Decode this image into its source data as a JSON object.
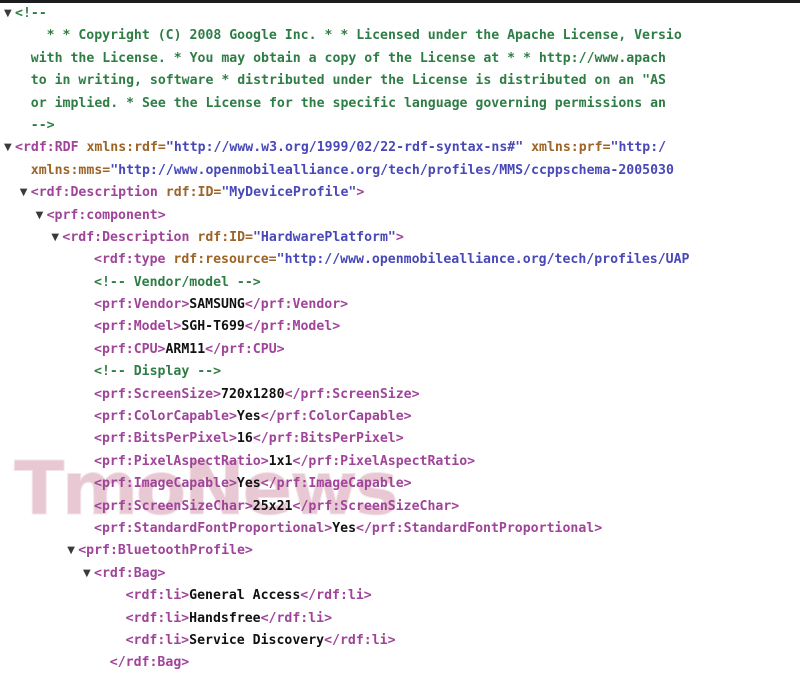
{
  "window": {
    "kind": "browser-xml-source-view",
    "background": "#ffffff"
  },
  "colors": {
    "tag": "#a0449a",
    "attribute_name": "#9c6426",
    "attribute_value": "#4848b8",
    "comment": "#2e7d45",
    "text": "#111111",
    "triangle": "#3a3a3a",
    "watermark": "#e7c4cf",
    "top_bar": "#1c1c1c"
  },
  "watermark": {
    "text": "TmoNews"
  },
  "code": {
    "lines": [
      {
        "id": "l1",
        "triangle": "open",
        "indent": 0,
        "segments": [
          {
            "cls": "comment",
            "text": "<!--"
          }
        ]
      },
      {
        "id": "l2",
        "triangle": "none",
        "indent": 2,
        "segments": [
          {
            "cls": "comment",
            "text": "* * Copyright (C) 2008 Google Inc. * * Licensed under the Apache License, Versio"
          }
        ]
      },
      {
        "id": "l3",
        "triangle": "none",
        "indent": 1,
        "segments": [
          {
            "cls": "comment",
            "text": "with the License. * You may obtain a copy of the License at * * http://www.apach"
          }
        ]
      },
      {
        "id": "l4",
        "triangle": "none",
        "indent": 1,
        "segments": [
          {
            "cls": "comment",
            "text": "to in writing, software * distributed under the License is distributed on an \"AS"
          }
        ]
      },
      {
        "id": "l5",
        "triangle": "none",
        "indent": 1,
        "segments": [
          {
            "cls": "comment",
            "text": "or implied. * See the License for the specific language governing permissions an"
          }
        ]
      },
      {
        "id": "l6",
        "triangle": "none",
        "indent": 1,
        "segments": [
          {
            "cls": "comment",
            "text": "-->"
          }
        ]
      },
      {
        "id": "l7",
        "triangle": "open",
        "indent": 0,
        "segments": [
          {
            "cls": "tag",
            "text": "<rdf:RDF "
          },
          {
            "cls": "attr",
            "text": "xmlns:rdf="
          },
          {
            "cls": "val",
            "text": "\"http://www.w3.org/1999/02/22-rdf-syntax-ns#\" "
          },
          {
            "cls": "attr",
            "text": "xmlns:prf="
          },
          {
            "cls": "val",
            "text": "\"http:/"
          }
        ]
      },
      {
        "id": "l8",
        "triangle": "none",
        "indent": 1,
        "segments": [
          {
            "cls": "attr",
            "text": "xmlns:mms="
          },
          {
            "cls": "val",
            "text": "\"http://www.openmobilealliance.org/tech/profiles/MMS/ccppschema-2005030"
          }
        ]
      },
      {
        "id": "l9",
        "triangle": "open",
        "indent": 1,
        "segments": [
          {
            "cls": "tag",
            "text": "<rdf:Description "
          },
          {
            "cls": "attr",
            "text": "rdf:ID="
          },
          {
            "cls": "val",
            "text": "\"MyDeviceProfile\""
          },
          {
            "cls": "tag",
            "text": ">"
          }
        ]
      },
      {
        "id": "l10",
        "triangle": "open",
        "indent": 2,
        "segments": [
          {
            "cls": "tag",
            "text": "<prf:component>"
          }
        ]
      },
      {
        "id": "l11",
        "triangle": "open",
        "indent": 3,
        "segments": [
          {
            "cls": "tag",
            "text": "<rdf:Description "
          },
          {
            "cls": "attr",
            "text": "rdf:ID="
          },
          {
            "cls": "val",
            "text": "\"HardwarePlatform\""
          },
          {
            "cls": "tag",
            "text": ">"
          }
        ]
      },
      {
        "id": "l12",
        "triangle": "none",
        "indent": 5,
        "segments": [
          {
            "cls": "tag",
            "text": "<rdf:type "
          },
          {
            "cls": "attr",
            "text": "rdf:resource="
          },
          {
            "cls": "val",
            "text": "\"http://www.openmobilealliance.org/tech/profiles/UAP"
          }
        ]
      },
      {
        "id": "l13",
        "triangle": "none",
        "indent": 5,
        "segments": [
          {
            "cls": "comment",
            "text": "<!-- Vendor/model -->"
          }
        ]
      },
      {
        "id": "l14",
        "triangle": "none",
        "indent": 5,
        "segments": [
          {
            "cls": "tag",
            "text": "<prf:Vendor>"
          },
          {
            "cls": "txt",
            "text": "SAMSUNG"
          },
          {
            "cls": "tag",
            "text": "</prf:Vendor>"
          }
        ]
      },
      {
        "id": "l15",
        "triangle": "none",
        "indent": 5,
        "segments": [
          {
            "cls": "tag",
            "text": "<prf:Model>"
          },
          {
            "cls": "txt",
            "text": "SGH-T699"
          },
          {
            "cls": "tag",
            "text": "</prf:Model>"
          }
        ]
      },
      {
        "id": "l16",
        "triangle": "none",
        "indent": 5,
        "segments": [
          {
            "cls": "tag",
            "text": "<prf:CPU>"
          },
          {
            "cls": "txt",
            "text": "ARM11"
          },
          {
            "cls": "tag",
            "text": "</prf:CPU>"
          }
        ]
      },
      {
        "id": "l17",
        "triangle": "none",
        "indent": 5,
        "segments": [
          {
            "cls": "comment",
            "text": "<!-- Display -->"
          }
        ]
      },
      {
        "id": "l18",
        "triangle": "none",
        "indent": 5,
        "segments": [
          {
            "cls": "tag",
            "text": "<prf:ScreenSize>"
          },
          {
            "cls": "txt",
            "text": "720x1280"
          },
          {
            "cls": "tag",
            "text": "</prf:ScreenSize>"
          }
        ]
      },
      {
        "id": "l19",
        "triangle": "none",
        "indent": 5,
        "segments": [
          {
            "cls": "tag",
            "text": "<prf:ColorCapable>"
          },
          {
            "cls": "txt",
            "text": "Yes"
          },
          {
            "cls": "tag",
            "text": "</prf:ColorCapable>"
          }
        ]
      },
      {
        "id": "l20",
        "triangle": "none",
        "indent": 5,
        "segments": [
          {
            "cls": "tag",
            "text": "<prf:BitsPerPixel>"
          },
          {
            "cls": "txt",
            "text": "16"
          },
          {
            "cls": "tag",
            "text": "</prf:BitsPerPixel>"
          }
        ]
      },
      {
        "id": "l21",
        "triangle": "none",
        "indent": 5,
        "segments": [
          {
            "cls": "tag",
            "text": "<prf:PixelAspectRatio>"
          },
          {
            "cls": "txt",
            "text": "1x1"
          },
          {
            "cls": "tag",
            "text": "</prf:PixelAspectRatio>"
          }
        ]
      },
      {
        "id": "l22",
        "triangle": "none",
        "indent": 5,
        "segments": [
          {
            "cls": "tag",
            "text": "<prf:ImageCapable>"
          },
          {
            "cls": "txt",
            "text": "Yes"
          },
          {
            "cls": "tag",
            "text": "</prf:ImageCapable>"
          }
        ]
      },
      {
        "id": "l23",
        "triangle": "none",
        "indent": 5,
        "segments": [
          {
            "cls": "tag",
            "text": "<prf:ScreenSizeChar>"
          },
          {
            "cls": "txt",
            "text": "25x21"
          },
          {
            "cls": "tag",
            "text": "</prf:ScreenSizeChar>"
          }
        ]
      },
      {
        "id": "l24",
        "triangle": "none",
        "indent": 5,
        "segments": [
          {
            "cls": "tag",
            "text": "<prf:StandardFontProportional>"
          },
          {
            "cls": "txt",
            "text": "Yes"
          },
          {
            "cls": "tag",
            "text": "</prf:StandardFontProportional>"
          }
        ]
      },
      {
        "id": "l25",
        "triangle": "open",
        "indent": 4,
        "segments": [
          {
            "cls": "tag",
            "text": "<prf:BluetoothProfile>"
          }
        ]
      },
      {
        "id": "l26",
        "triangle": "open",
        "indent": 5,
        "segments": [
          {
            "cls": "tag",
            "text": "<rdf:Bag>"
          }
        ]
      },
      {
        "id": "l27",
        "triangle": "none",
        "indent": 7,
        "segments": [
          {
            "cls": "tag",
            "text": "<rdf:li>"
          },
          {
            "cls": "txt",
            "text": "General Access"
          },
          {
            "cls": "tag",
            "text": "</rdf:li>"
          }
        ]
      },
      {
        "id": "l28",
        "triangle": "none",
        "indent": 7,
        "segments": [
          {
            "cls": "tag",
            "text": "<rdf:li>"
          },
          {
            "cls": "txt",
            "text": "Handsfree"
          },
          {
            "cls": "tag",
            "text": "</rdf:li>"
          }
        ]
      },
      {
        "id": "l29",
        "triangle": "none",
        "indent": 7,
        "segments": [
          {
            "cls": "tag",
            "text": "<rdf:li>"
          },
          {
            "cls": "txt",
            "text": "Service Discovery"
          },
          {
            "cls": "tag",
            "text": "</rdf:li>"
          }
        ]
      },
      {
        "id": "l30",
        "triangle": "none",
        "indent": 6,
        "segments": [
          {
            "cls": "tag",
            "text": "</rdf:Bag>"
          }
        ]
      }
    ]
  }
}
